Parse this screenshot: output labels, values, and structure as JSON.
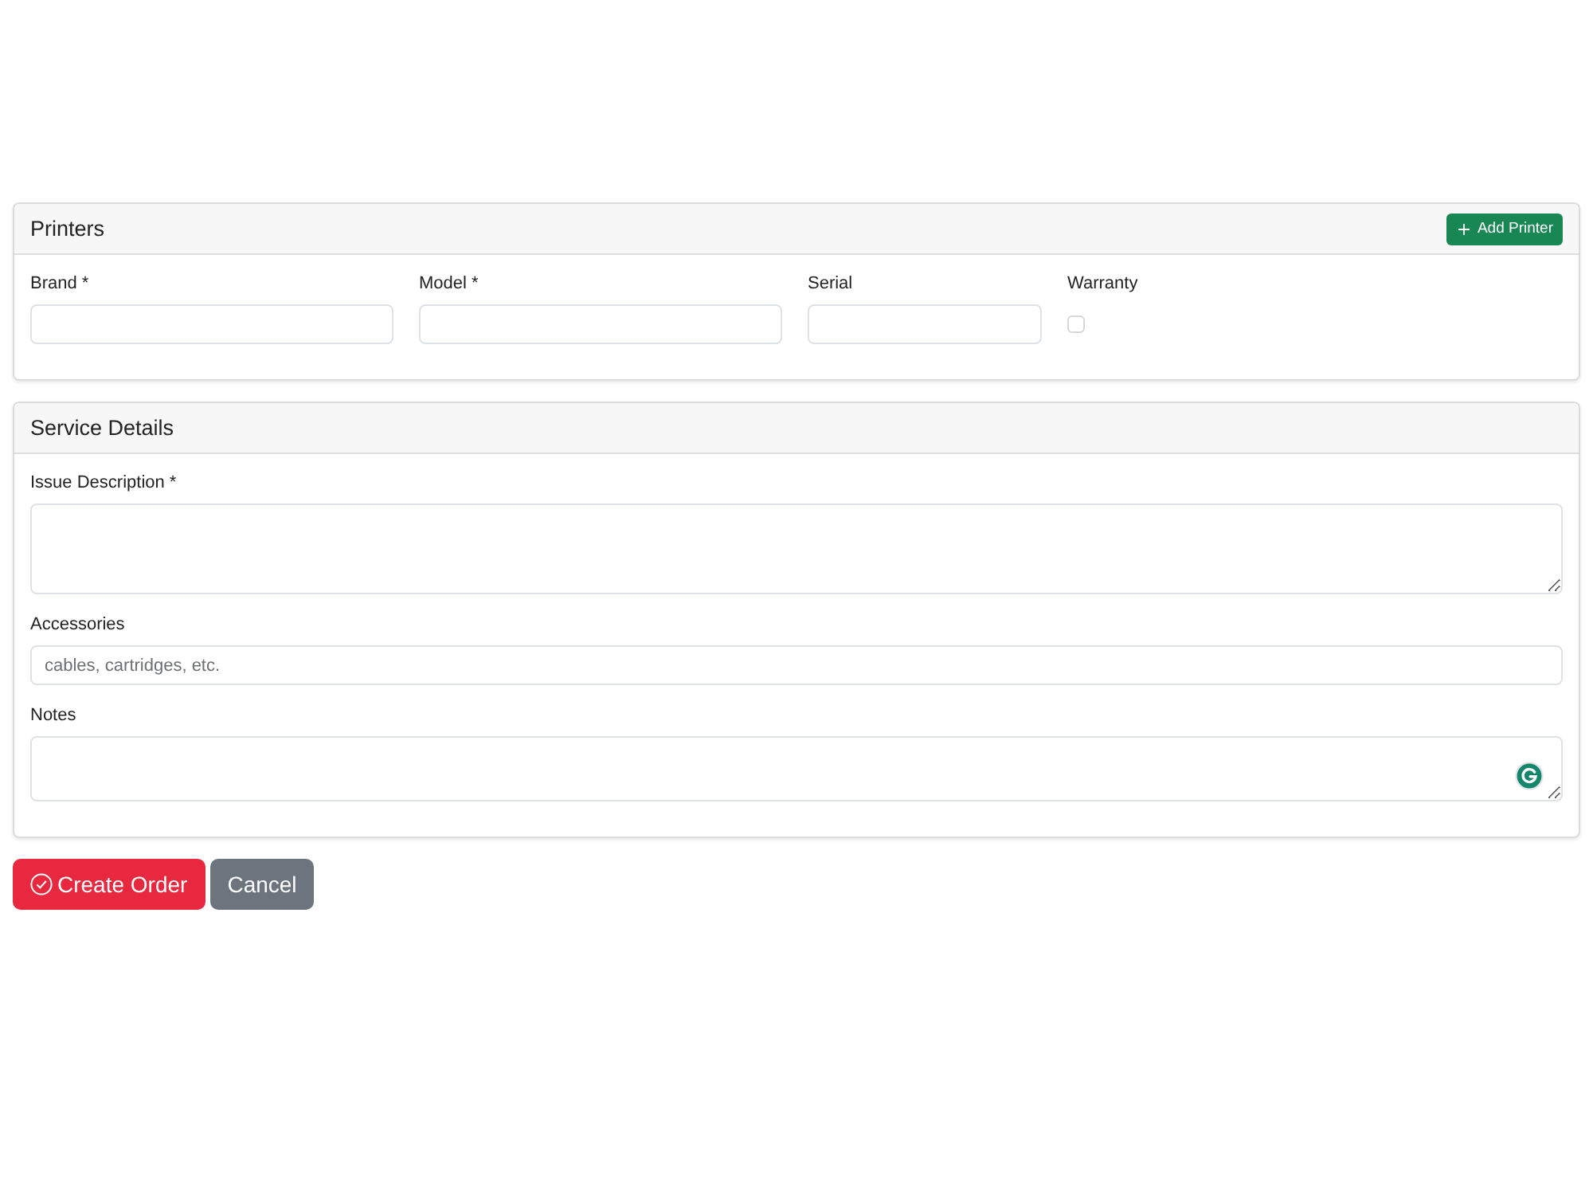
{
  "printers": {
    "title": "Printers",
    "add_button": {
      "label": "Add Printer"
    },
    "fields": [
      {
        "kind": "text",
        "label": "Brand *"
      },
      {
        "kind": "text",
        "label": "Model *"
      },
      {
        "kind": "text",
        "label": "Serial"
      },
      {
        "kind": "checkbox",
        "label": "Warranty",
        "checked": false
      }
    ]
  },
  "service_details": {
    "title": "Service Details",
    "fields": [
      {
        "kind": "textarea",
        "label": "Issue Description *"
      },
      {
        "kind": "text",
        "label": "Accessories",
        "placeholder": "cables, cartridges, etc."
      },
      {
        "kind": "textarea",
        "label": "Notes"
      }
    ]
  },
  "actions": [
    {
      "kind": "primary",
      "label": "Create Order"
    },
    {
      "kind": "secondary",
      "label": "Cancel"
    }
  ]
}
